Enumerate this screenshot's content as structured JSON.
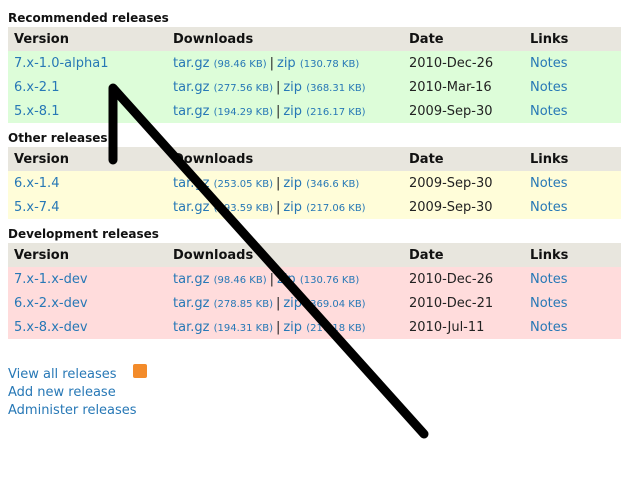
{
  "sections": [
    {
      "title": "Recommended releases",
      "row_class": "green",
      "headers": [
        "Version",
        "Downloads",
        "Date",
        "Links"
      ],
      "rows": [
        {
          "version": "7.x-1.0-alpha1",
          "targz": "tar.gz",
          "targz_size": "(98.46 KB)",
          "zip": "zip",
          "zip_size": "(130.78 KB)",
          "date": "2010-Dec-26",
          "notes": "Notes"
        },
        {
          "version": "6.x-2.1",
          "targz": "tar.gz",
          "targz_size": "(277.56 KB)",
          "zip": "zip",
          "zip_size": "(368.31 KB)",
          "date": "2010-Mar-16",
          "notes": "Notes"
        },
        {
          "version": "5.x-8.1",
          "targz": "tar.gz",
          "targz_size": "(194.29 KB)",
          "zip": "zip",
          "zip_size": "(216.17 KB)",
          "date": "2009-Sep-30",
          "notes": "Notes"
        }
      ]
    },
    {
      "title": "Other releases",
      "row_class": "yellow",
      "headers": [
        "Version",
        "Downloads",
        "Date",
        "Links"
      ],
      "rows": [
        {
          "version": "6.x-1.4",
          "targz": "tar.gz",
          "targz_size": "(253.05 KB)",
          "zip": "zip",
          "zip_size": "(346.6 KB)",
          "date": "2009-Sep-30",
          "notes": "Notes"
        },
        {
          "version": "5.x-7.4",
          "targz": "tar.gz",
          "targz_size": "(193.59 KB)",
          "zip": "zip",
          "zip_size": "(217.06 KB)",
          "date": "2009-Sep-30",
          "notes": "Notes"
        }
      ]
    },
    {
      "title": "Development releases",
      "row_class": "red",
      "headers": [
        "Version",
        "Downloads",
        "Date",
        "Links"
      ],
      "rows": [
        {
          "version": "7.x-1.x-dev",
          "targz": "tar.gz",
          "targz_size": "(98.46 KB)",
          "zip": "zip",
          "zip_size": "(130.76 KB)",
          "date": "2010-Dec-26",
          "notes": "Notes"
        },
        {
          "version": "6.x-2.x-dev",
          "targz": "tar.gz",
          "targz_size": "(278.85 KB)",
          "zip": "zip",
          "zip_size": "(369.04 KB)",
          "date": "2010-Dec-21",
          "notes": "Notes"
        },
        {
          "version": "5.x-8.x-dev",
          "targz": "tar.gz",
          "targz_size": "(194.31 KB)",
          "zip": "zip",
          "zip_size": "(216.18 KB)",
          "date": "2010-Jul-11",
          "notes": "Notes"
        }
      ]
    }
  ],
  "footer_links": {
    "view_all": "View all releases",
    "add_new": "Add new release",
    "administer": "Administer releases",
    "rss_icon": "rss-feed-icon"
  },
  "colors": {
    "recommended_row": "#ddfdd9",
    "other_row": "#fffdd9",
    "development_row": "#ffdcdc",
    "header_row": "#e8e6de",
    "link": "#2778b6",
    "annotation_arrow": "#000000"
  }
}
